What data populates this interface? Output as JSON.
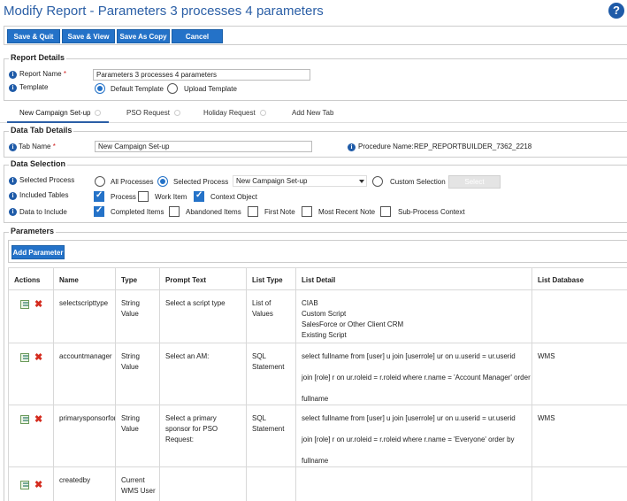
{
  "page": {
    "title": "Modify Report - Parameters 3 processes 4 parameters",
    "help_icon": "?"
  },
  "toolbar": {
    "save_quit": "Save & Quit",
    "save_view": "Save & View",
    "save_as_copy": "Save As Copy",
    "cancel": "Cancel"
  },
  "report_details": {
    "title": "Report Details",
    "name_label": "Report Name",
    "required_mark": "*",
    "name_value": "Parameters 3 processes 4 parameters",
    "template_label": "Template",
    "default_template": "Default Template",
    "upload_template": "Upload Template"
  },
  "tabs": [
    {
      "label": "New Campaign Set-up"
    },
    {
      "label": "PSO Request"
    },
    {
      "label": "Holiday Request"
    },
    {
      "label": "Add New Tab"
    }
  ],
  "data_tab": {
    "title": "Data Tab Details",
    "tab_name_label": "Tab Name",
    "required_mark": "*",
    "tab_name_value": "New Campaign Set-up",
    "procedure_label": "Procedure Name:",
    "procedure_value": "REP_REPORTBUILDER_7362_2218"
  },
  "data_selection": {
    "title": "Data Selection",
    "selected_process_label": "Selected Process",
    "all_processes": "All Processes",
    "selected_process_option": "Selected Process",
    "process_dropdown_value": "New Campaign Set-up",
    "custom_selection": "Custom Selection",
    "select_button": "Select",
    "included_tables_label": "Included Tables",
    "tables": [
      "Process",
      "Work Item",
      "Context Object"
    ],
    "data_to_include_label": "Data to Include",
    "include": [
      "Completed Items",
      "Abandoned Items",
      "First Note",
      "Most Recent Note",
      "Sub-Process Context"
    ]
  },
  "parameters": {
    "title": "Parameters",
    "add_button": "Add Parameter",
    "columns": [
      "Actions",
      "Name",
      "Type",
      "Prompt Text",
      "List Type",
      "List Detail",
      "List Database"
    ],
    "rows": [
      {
        "name": "selectscripttype",
        "type": "String Value",
        "prompt": "Select a script type",
        "list_type": "List of Values",
        "detail": [
          "CIAB",
          "Custom Script",
          "SalesForce or Other Client CRM",
          "Existing Script"
        ],
        "database": ""
      },
      {
        "name": "accountmanager",
        "type": "String Value",
        "prompt": "Select an AM:",
        "list_type": "SQL Statement",
        "detail": [
          "select fullname from [user] u join [userrole] ur on u.userid = ur.userid",
          "join [role] r on ur.roleid = r.roleid where r.name = 'Account Manager' order by",
          "fullname"
        ],
        "database": "WMS"
      },
      {
        "name": "primarysponsorforre",
        "type": "String Value",
        "prompt": "Select a primary sponsor for PSO Request:",
        "list_type": "SQL Statement",
        "detail": [
          "select fullname from [user] u join [userrole] ur on u.userid = ur.userid",
          "join [role] r on ur.roleid = r.roleid where r.name = 'Everyone' order by",
          "fullname"
        ],
        "database": "WMS"
      },
      {
        "name": "createdby",
        "type": "Current WMS User",
        "prompt": "",
        "list_type": "",
        "detail": [],
        "database": ""
      }
    ]
  }
}
